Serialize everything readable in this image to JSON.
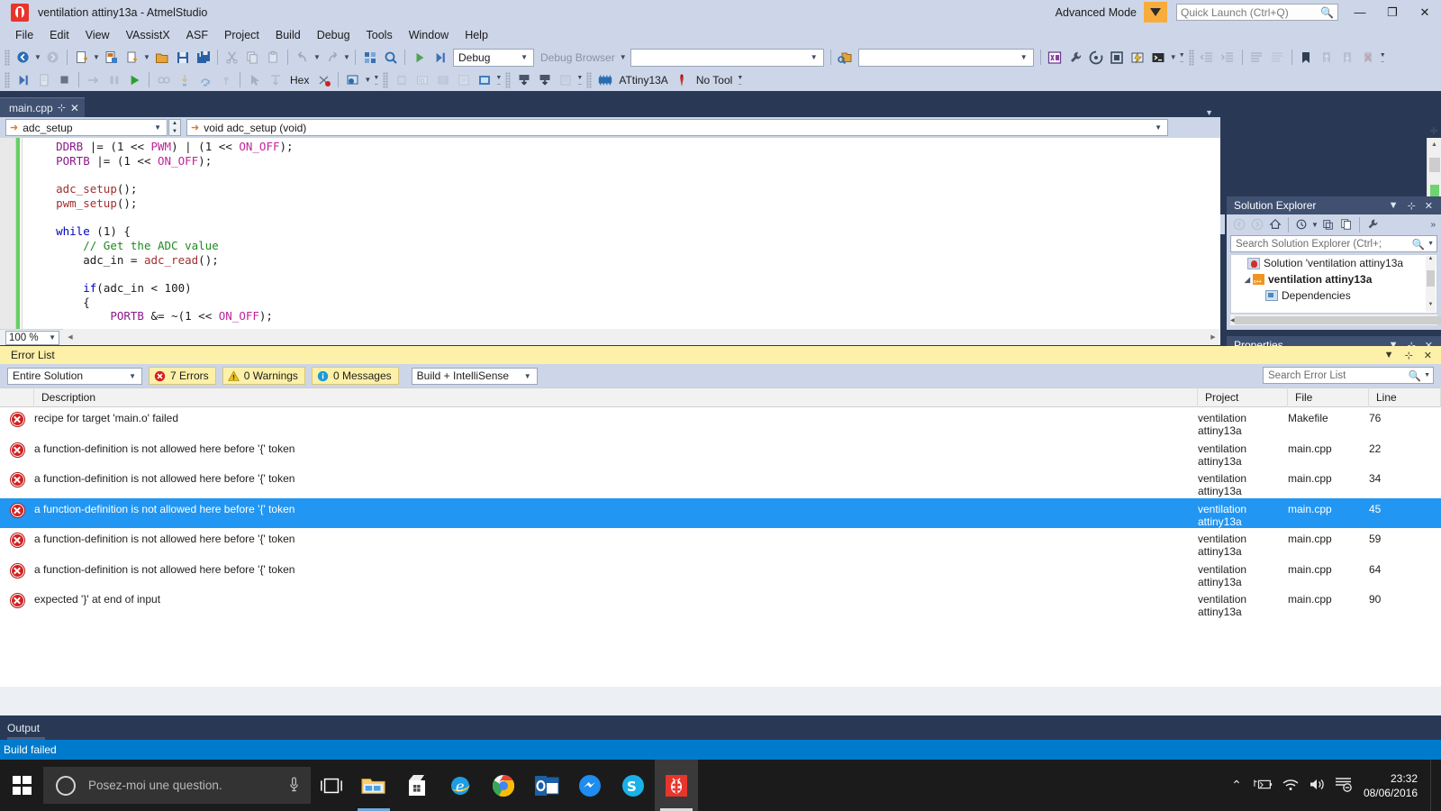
{
  "window": {
    "title": "ventilation attiny13a - AtmelStudio",
    "advanced_mode": "Advanced Mode",
    "quick_launch_placeholder": "Quick Launch (Ctrl+Q)",
    "minimize": "—",
    "restore": "❐",
    "close": "✕"
  },
  "menu": {
    "items": [
      "File",
      "Edit",
      "View",
      "VAssistX",
      "ASF",
      "Project",
      "Build",
      "Debug",
      "Tools",
      "Window",
      "Help"
    ]
  },
  "toolbar": {
    "config_value": "Debug",
    "debug_browser_label": "Debug Browser",
    "debug_browser_value": "",
    "hex_label": "Hex",
    "device_label": "ATtiny13A",
    "tool_label": "No Tool"
  },
  "editor": {
    "tab_name": "main.cpp",
    "nav_left": "adc_setup",
    "nav_right": "void adc_setup (void)",
    "go_label": "Go",
    "zoom": "100 %",
    "code_lines": [
      {
        "indent": 4,
        "tokens": [
          {
            "t": "DDRB ",
            "c": "id"
          },
          {
            "t": "|= (",
            "c": "pl"
          },
          {
            "t": "1",
            "c": "pl"
          },
          {
            "t": " << ",
            "c": "pl"
          },
          {
            "t": "PWM",
            "c": "mac"
          },
          {
            "t": ") | (",
            "c": "pl"
          },
          {
            "t": "1",
            "c": "pl"
          },
          {
            "t": " << ",
            "c": "pl"
          },
          {
            "t": "ON_OFF",
            "c": "mac"
          },
          {
            "t": ");",
            "c": "pl"
          }
        ]
      },
      {
        "indent": 4,
        "tokens": [
          {
            "t": "PORTB ",
            "c": "id"
          },
          {
            "t": "|= (",
            "c": "pl"
          },
          {
            "t": "1",
            "c": "pl"
          },
          {
            "t": " << ",
            "c": "pl"
          },
          {
            "t": "ON_OFF",
            "c": "mac"
          },
          {
            "t": ");",
            "c": "pl"
          }
        ]
      },
      {
        "indent": 0,
        "tokens": []
      },
      {
        "indent": 4,
        "tokens": [
          {
            "t": "adc_setup",
            "c": "fn"
          },
          {
            "t": "();",
            "c": "pl"
          }
        ]
      },
      {
        "indent": 4,
        "tokens": [
          {
            "t": "pwm_setup",
            "c": "fn"
          },
          {
            "t": "();",
            "c": "pl"
          }
        ]
      },
      {
        "indent": 0,
        "tokens": []
      },
      {
        "indent": 4,
        "tokens": [
          {
            "t": "while",
            "c": "k"
          },
          {
            "t": " (",
            "c": "pl"
          },
          {
            "t": "1",
            "c": "pl"
          },
          {
            "t": ") {",
            "c": "pl"
          }
        ]
      },
      {
        "indent": 8,
        "tokens": [
          {
            "t": "// Get the ADC value",
            "c": "cm"
          }
        ]
      },
      {
        "indent": 8,
        "tokens": [
          {
            "t": "adc_in",
            "c": "pl"
          },
          {
            "t": " = ",
            "c": "pl"
          },
          {
            "t": "adc_read",
            "c": "fn"
          },
          {
            "t": "();",
            "c": "pl"
          }
        ]
      },
      {
        "indent": 0,
        "tokens": []
      },
      {
        "indent": 8,
        "tokens": [
          {
            "t": "if",
            "c": "k"
          },
          {
            "t": "(",
            "c": "pl"
          },
          {
            "t": "adc_in",
            "c": "pl"
          },
          {
            "t": " < ",
            "c": "pl"
          },
          {
            "t": "100",
            "c": "pl"
          },
          {
            "t": ")",
            "c": "pl"
          }
        ]
      },
      {
        "indent": 8,
        "tokens": [
          {
            "t": "{",
            "c": "pl"
          }
        ]
      },
      {
        "indent": 12,
        "tokens": [
          {
            "t": "PORTB ",
            "c": "id"
          },
          {
            "t": "&= ~(",
            "c": "pl"
          },
          {
            "t": "1",
            "c": "pl"
          },
          {
            "t": " << ",
            "c": "pl"
          },
          {
            "t": "ON_OFF",
            "c": "mac"
          },
          {
            "t": ");",
            "c": "pl"
          }
        ]
      }
    ]
  },
  "solution_explorer": {
    "title": "Solution Explorer",
    "search_placeholder": "Search Solution Explorer (Ctrl+;",
    "tree": [
      {
        "label": "Solution 'ventilation attiny13a",
        "icon": "solution-icon",
        "twisty": "",
        "bold": false,
        "depth": 0
      },
      {
        "label": "ventilation attiny13a",
        "icon": "project-icon",
        "twisty": "◢",
        "bold": true,
        "depth": 1
      },
      {
        "label": "Dependencies",
        "icon": "dependencies-icon",
        "twisty": "",
        "bold": false,
        "depth": 2
      }
    ]
  },
  "properties": {
    "title": "Properties"
  },
  "error_list": {
    "title": "Error List",
    "scope_value": "Entire Solution",
    "errors_label": "7 Errors",
    "warnings_label": "0 Warnings",
    "messages_label": "0 Messages",
    "source_value": "Build + IntelliSense",
    "search_placeholder": "Search Error List",
    "columns": [
      "Description",
      "Project",
      "File",
      "Line"
    ],
    "rows": [
      {
        "desc": "recipe for target 'main.o' failed",
        "project": "ventilation attiny13a",
        "file": "Makefile",
        "line": "76",
        "selected": false
      },
      {
        "desc": "a function-definition is not allowed here before '{' token",
        "project": "ventilation attiny13a",
        "file": "main.cpp",
        "line": "22",
        "selected": false
      },
      {
        "desc": "a function-definition is not allowed here before '{' token",
        "project": "ventilation attiny13a",
        "file": "main.cpp",
        "line": "34",
        "selected": false
      },
      {
        "desc": "a function-definition is not allowed here before '{' token",
        "project": "ventilation attiny13a",
        "file": "main.cpp",
        "line": "45",
        "selected": true
      },
      {
        "desc": "a function-definition is not allowed here before '{' token",
        "project": "ventilation attiny13a",
        "file": "main.cpp",
        "line": "59",
        "selected": false
      },
      {
        "desc": "a function-definition is not allowed here before '{' token",
        "project": "ventilation attiny13a",
        "file": "main.cpp",
        "line": "64",
        "selected": false
      },
      {
        "desc": "expected '}' at end of input",
        "project": "ventilation attiny13a",
        "file": "main.cpp",
        "line": "90",
        "selected": false
      }
    ]
  },
  "output": {
    "label": "Output"
  },
  "status": {
    "text": "Build failed"
  },
  "taskbar": {
    "search_placeholder": "Posez-moi une question.",
    "apps": [
      "file-explorer",
      "microsoft-store",
      "internet-explorer",
      "google-chrome",
      "outlook",
      "messenger",
      "skype",
      "atmel-studio"
    ],
    "time": "23:32",
    "date": "08/06/2016"
  },
  "colors": {
    "accent": "#007acc",
    "selection": "#2196f3",
    "chrome": "#ccd6e8",
    "dark_chrome": "#293955",
    "warn_yellow": "#fdf0a8",
    "error_red": "#d42020"
  }
}
